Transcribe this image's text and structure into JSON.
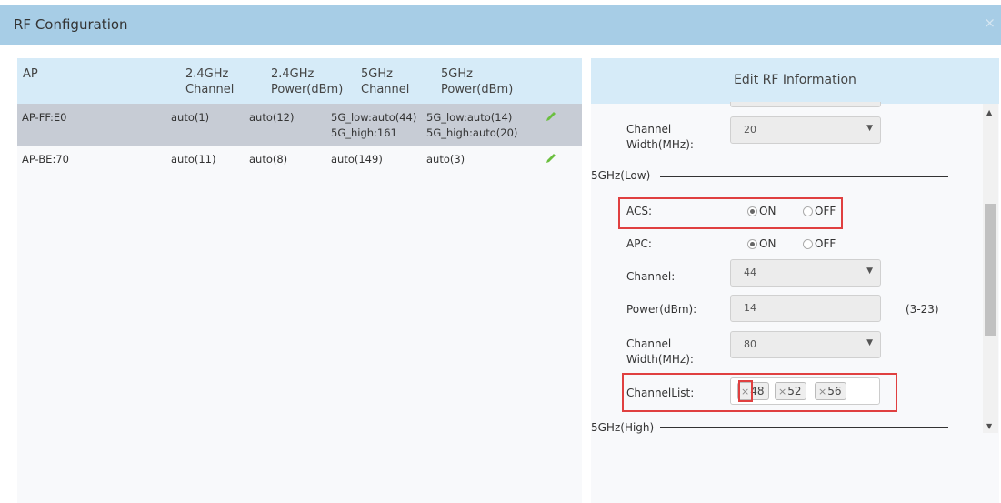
{
  "window": {
    "title": "RF Configuration",
    "close": "×"
  },
  "table": {
    "headers": {
      "ap": "AP",
      "ch24_l1": "2.4GHz",
      "ch24_l2": "Channel",
      "pw24_l1": "2.4GHz",
      "pw24_l2": "Power(dBm)",
      "ch5_l1": "5GHz",
      "ch5_l2": "Channel",
      "pw5_l1": "5GHz",
      "pw5_l2": "Power(dBm)"
    },
    "rows": [
      {
        "ap": "AP-FF:E0",
        "ch24": "auto(1)",
        "pw24": "auto(12)",
        "ch5_a": "5G_low:auto(44)",
        "ch5_b": "5G_high:161",
        "pw5_a": "5G_low:auto(14)",
        "pw5_b": "5G_high:auto(20)"
      },
      {
        "ap": "AP-BE:70",
        "ch24": "auto(11)",
        "pw24": "auto(8)",
        "ch5_a": "auto(149)",
        "pw5_a": "auto(3)"
      }
    ]
  },
  "edit": {
    "title": "Edit RF Information",
    "top_width_label_1": "Channel",
    "top_width_label_2": "Width(MHz):",
    "top_width_value": "20",
    "low_section": "5GHz(Low)",
    "acs_label": "ACS:",
    "apc_label": "APC:",
    "on": "ON",
    "off": "OFF",
    "acs_value": "ON",
    "apc_value": "ON",
    "channel_label": "Channel:",
    "channel_value": "44",
    "power_label": "Power(dBm):",
    "power_value": "14",
    "power_range": "(3-23)",
    "width_label_1": "Channel",
    "width_label_2": "Width(MHz):",
    "width_value": "80",
    "channellist_label": "ChannelList:",
    "channel_tags": [
      "48",
      "52",
      "56"
    ],
    "tag_remove": "×",
    "high_section": "5GHz(High)"
  },
  "colors": {
    "header_bg": "#a7cde6",
    "table_head_bg": "#d6ebf8",
    "selected_row": "#c7ccd5",
    "highlight": "#e04040",
    "pencil": "#6bbf3f"
  }
}
